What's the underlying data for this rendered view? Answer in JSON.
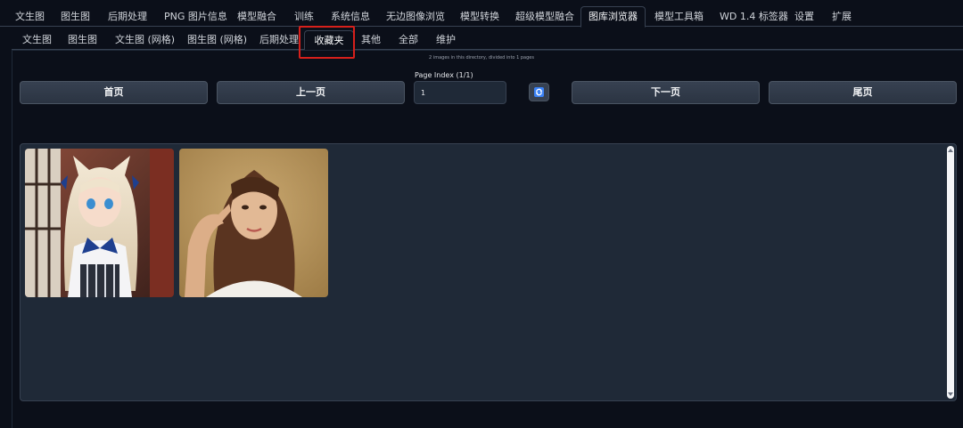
{
  "top_tabs": [
    "文生图",
    "图生图",
    "后期处理",
    "PNG 图片信息",
    "模型融合",
    "训练",
    "系统信息",
    "无边图像浏览",
    "模型转换",
    "超级模型融合",
    "图库浏览器",
    "模型工具箱",
    "WD 1.4 标签器",
    "设置",
    "扩展"
  ],
  "sub_tabs": [
    "文生图",
    "图生图",
    "文生图 (网格)",
    "图生图 (网格)",
    "后期处理",
    "收藏夹",
    "其他",
    "全部",
    "维护"
  ],
  "dir_info": "2 images in this directory, divided into 1 pages",
  "buttons": {
    "first": "首页",
    "prev": "上一页",
    "next": "下一页",
    "last": "尾页"
  },
  "page_index": {
    "label": "Page Index (1/1)",
    "value": "1"
  },
  "gallery": {
    "images": [
      {
        "name": "anime-catgirl-image"
      },
      {
        "name": "woman-portrait-image"
      }
    ]
  },
  "colors": {
    "background": "#0b0f19",
    "panel": "#1f2937",
    "highlight": "#d7201b",
    "refresh": "#3b82f6"
  },
  "icons": [
    "refresh-icon"
  ]
}
